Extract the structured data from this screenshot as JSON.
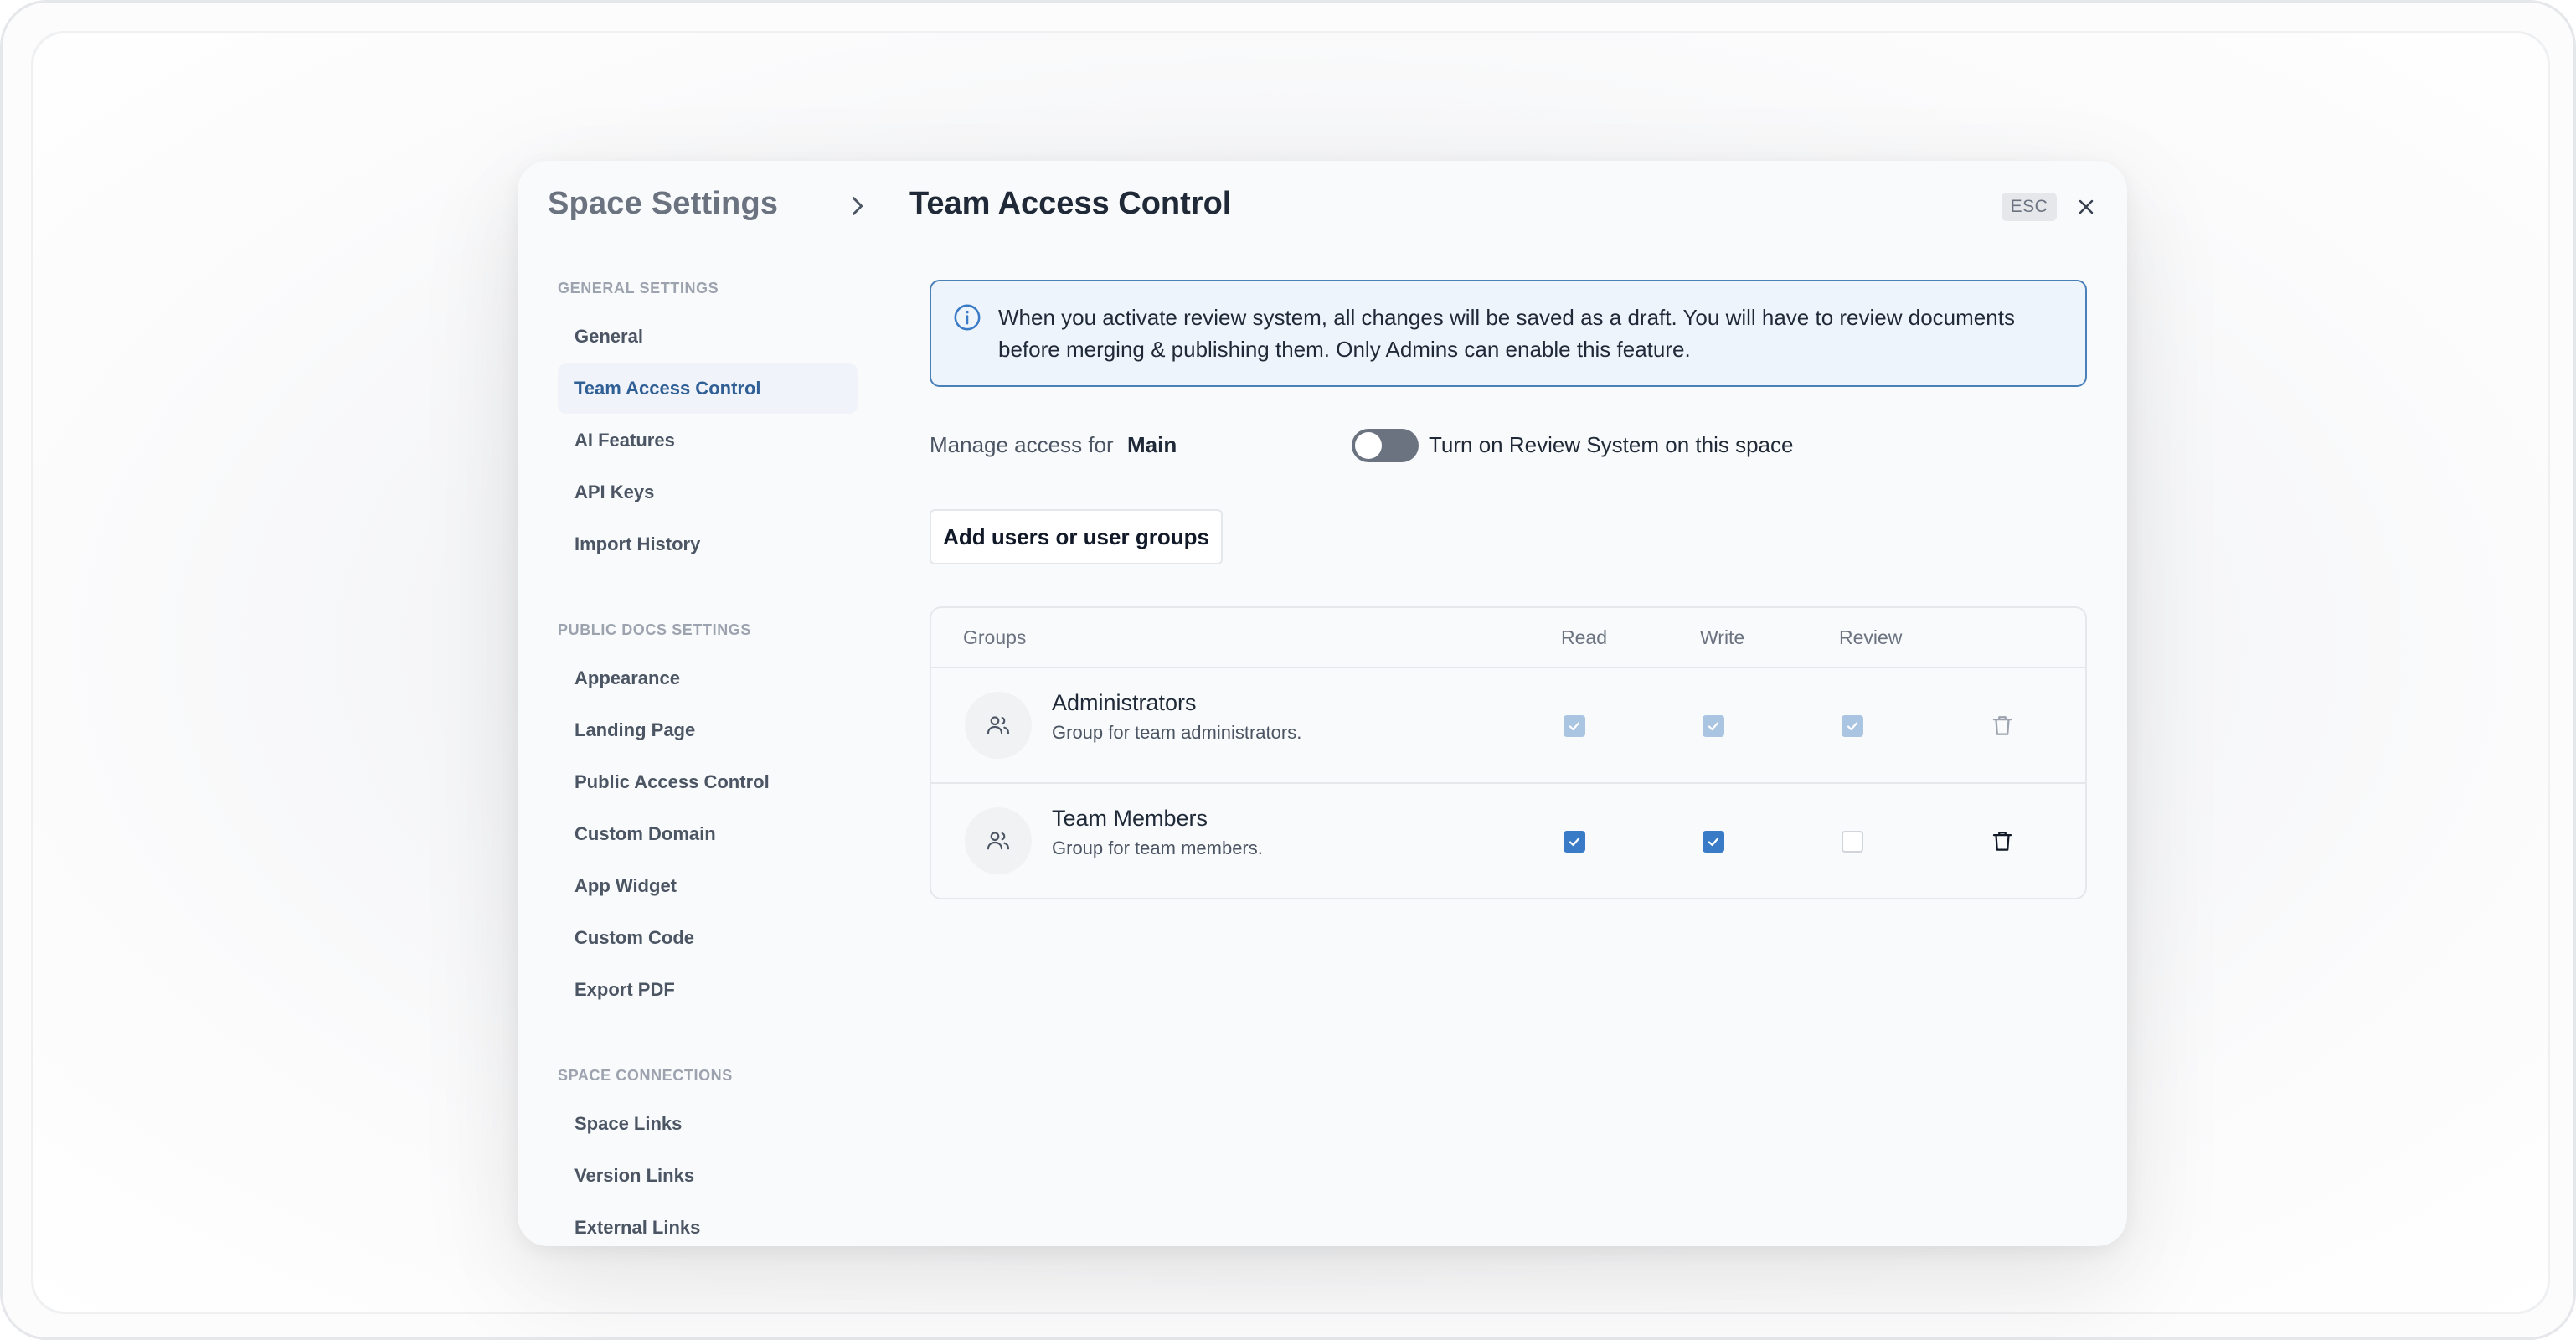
{
  "header": {
    "parent_title": "Space Settings",
    "page_title": "Team Access Control",
    "esc_label": "ESC"
  },
  "sidebar": {
    "sections": [
      {
        "heading": "GENERAL SETTINGS",
        "items": [
          {
            "label": "General"
          },
          {
            "label": "Team Access Control",
            "active": true
          },
          {
            "label": "AI Features"
          },
          {
            "label": "API Keys"
          },
          {
            "label": "Import History"
          }
        ]
      },
      {
        "heading": "PUBLIC DOCS SETTINGS",
        "items": [
          {
            "label": "Appearance"
          },
          {
            "label": "Landing Page"
          },
          {
            "label": "Public Access Control"
          },
          {
            "label": "Custom Domain"
          },
          {
            "label": "App Widget"
          },
          {
            "label": "Custom Code"
          },
          {
            "label": "Export PDF"
          }
        ]
      },
      {
        "heading": "SPACE CONNECTIONS",
        "items": [
          {
            "label": "Space Links"
          },
          {
            "label": "Version Links"
          },
          {
            "label": "External Links"
          }
        ]
      }
    ]
  },
  "main": {
    "info_line1": "When you activate review system, all changes will be saved as a draft. You will have to review documents",
    "info_line2": "before merging & publishing them. Only Admins can enable this feature.",
    "manage_label": "Manage access for",
    "manage_value": "Main",
    "review_toggle": {
      "label": "Turn on Review System on this space",
      "on": false
    },
    "add_button": "Add users or user groups",
    "table": {
      "columns": [
        "Groups",
        "Read",
        "Write",
        "Review"
      ],
      "rows": [
        {
          "name": "Administrators",
          "description": "Group for team administrators.",
          "read": true,
          "write": true,
          "review": true,
          "locked": true
        },
        {
          "name": "Team Members",
          "description": "Group for team members.",
          "read": true,
          "write": true,
          "review": false,
          "locked": false
        }
      ]
    }
  },
  "colors": {
    "accent": "#3a7bc8",
    "info_border": "#4a80b8",
    "active_item_text": "#2f5f95"
  }
}
